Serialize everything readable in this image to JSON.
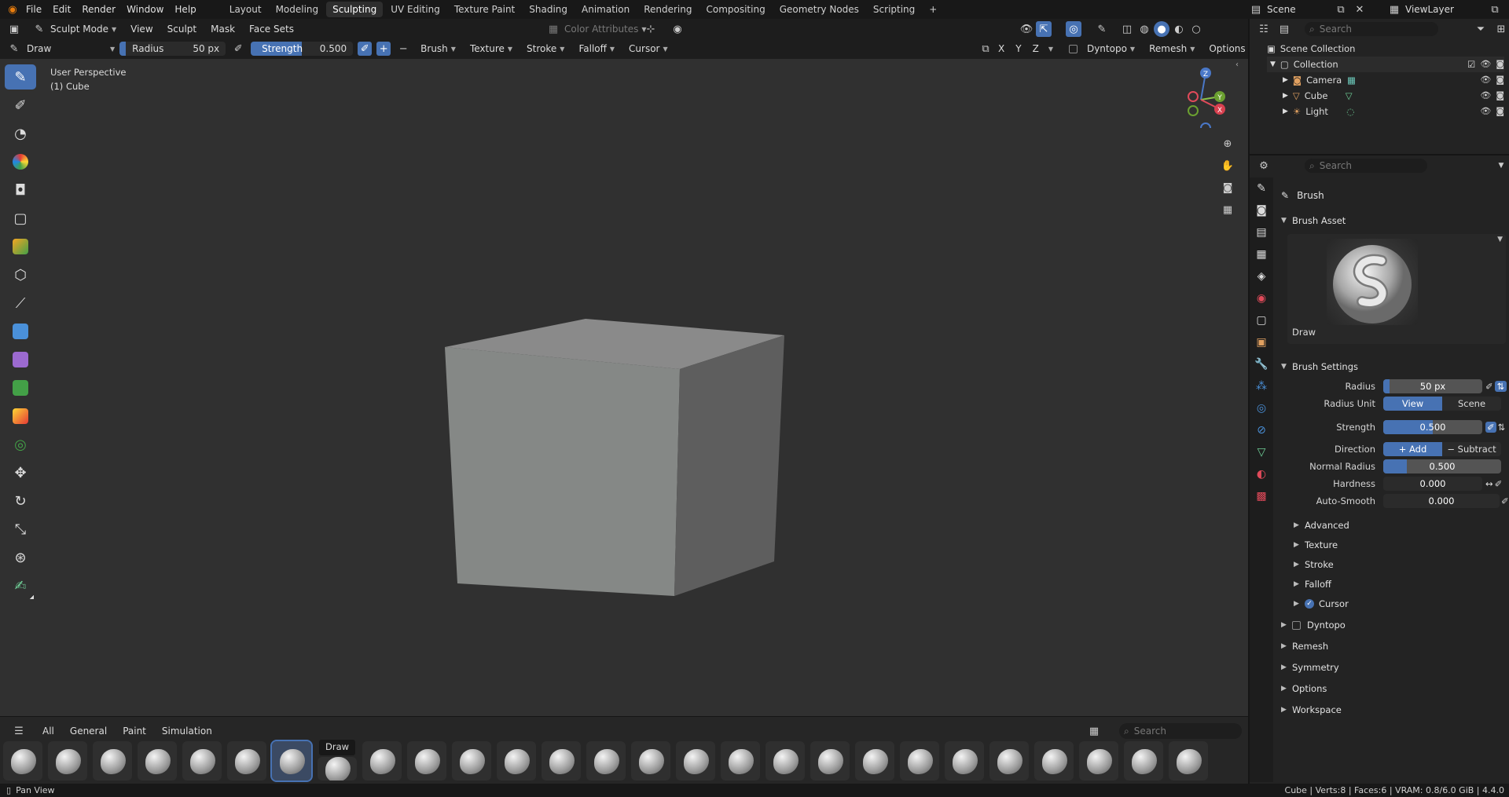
{
  "topbar": {
    "menus": [
      "File",
      "Edit",
      "Render",
      "Window",
      "Help"
    ],
    "workspaces": [
      "Layout",
      "Modeling",
      "Sculpting",
      "UV Editing",
      "Texture Paint",
      "Shading",
      "Animation",
      "Rendering",
      "Compositing",
      "Geometry Nodes",
      "Scripting"
    ],
    "active_workspace": "Sculpting",
    "add_tab": "+",
    "scene": "Scene",
    "view_layer": "ViewLayer"
  },
  "viewport_header": {
    "mode": "Sculpt Mode",
    "menus": [
      "View",
      "Sculpt",
      "Mask",
      "Face Sets"
    ],
    "color_attributes": "Color Attributes"
  },
  "tool_header": {
    "tool": "Draw",
    "radius_label": "Radius",
    "radius_value": "50 px",
    "strength_label": "Strength",
    "strength_value": "0.500",
    "plus": "+",
    "minus": "−",
    "menus": [
      "Brush",
      "Texture",
      "Stroke",
      "Falloff",
      "Cursor"
    ],
    "axes": [
      "X",
      "Y",
      "Z"
    ],
    "dyntopo": "Dyntopo",
    "remesh": "Remesh",
    "options": "Options"
  },
  "viewport": {
    "perspective": "User Perspective",
    "object": "(1) Cube",
    "gizmo": {
      "z": "Z",
      "y": "Y",
      "x": "X"
    }
  },
  "outliner": {
    "search_placeholder": "Search",
    "scene_collection": "Scene Collection",
    "collection": "Collection",
    "items": [
      "Camera",
      "Cube",
      "Light"
    ]
  },
  "properties": {
    "search_placeholder": "Search",
    "brush_title": "Brush",
    "brush_asset": "Brush Asset",
    "brush_name": "Draw",
    "brush_settings": "Brush Settings",
    "radius_label": "Radius",
    "radius_value": "50 px",
    "radius_unit_label": "Radius Unit",
    "radius_unit_view": "View",
    "radius_unit_scene": "Scene",
    "strength_label": "Strength",
    "strength_value": "0.500",
    "strength_fill": 0.5,
    "direction_label": "Direction",
    "direction_add": "Add",
    "direction_subtract": "Subtract",
    "normal_radius_label": "Normal Radius",
    "normal_radius_value": "0.500",
    "normal_radius_fill": 0.2,
    "hardness_label": "Hardness",
    "hardness_value": "0.000",
    "autosmooth_label": "Auto-Smooth",
    "autosmooth_value": "0.000",
    "subsections": [
      "Advanced",
      "Texture",
      "Stroke",
      "Falloff",
      "Cursor"
    ],
    "dyntopo": "Dyntopo",
    "sections": [
      "Remesh",
      "Symmetry",
      "Options",
      "Workspace"
    ]
  },
  "shelf": {
    "tabs": [
      "All",
      "General",
      "Paint",
      "Simulation"
    ],
    "search_placeholder": "Search",
    "tooltip": "Draw"
  },
  "status": {
    "left": "Pan View",
    "right": "Cube | Verts:8 | Faces:6 | VRAM: 0.8/6.0 GiB | 4.4.0"
  },
  "colors": {
    "accent": "#4772b3",
    "bg": "#303030",
    "panel": "#232323"
  }
}
